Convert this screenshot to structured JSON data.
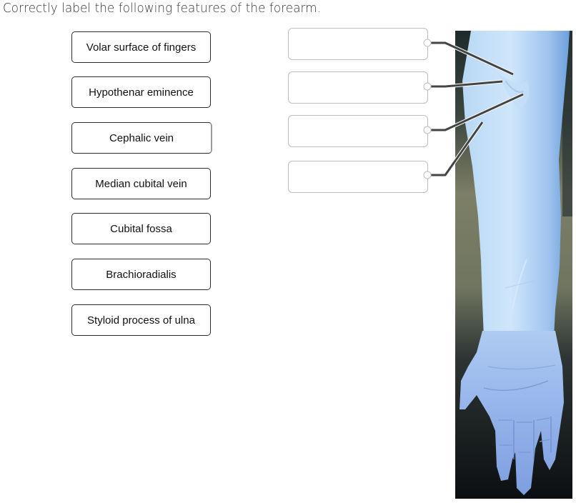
{
  "question": {
    "title": "Correctly label the following features of the forearm."
  },
  "labels": [
    {
      "text": "Volar surface of fingers"
    },
    {
      "text": "Hypothenar eminence"
    },
    {
      "text": "Cephalic vein",
      "state": "hover"
    },
    {
      "text": "Median cubital vein"
    },
    {
      "text": "Cubital fossa"
    },
    {
      "text": "Brachioradialis"
    },
    {
      "text": "Styloid process of ulna"
    }
  ],
  "drop_targets": [
    {
      "value": ""
    },
    {
      "value": ""
    },
    {
      "value": ""
    },
    {
      "value": ""
    }
  ],
  "image": {
    "subject": "anterior view of forearm and hand, blue-tinted photograph",
    "leader_line_color": "#444444"
  }
}
